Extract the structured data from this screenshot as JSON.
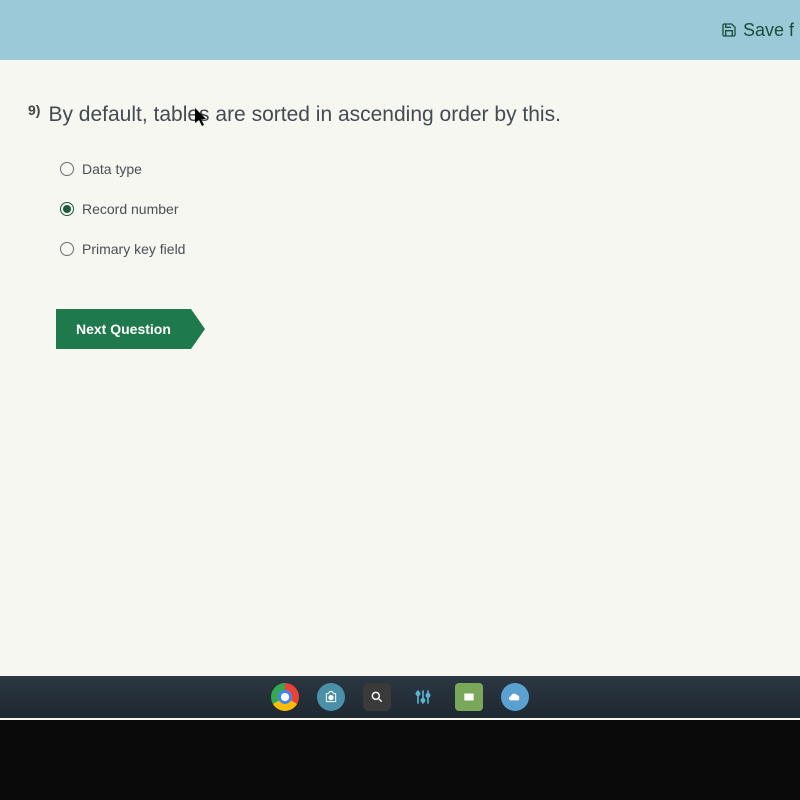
{
  "toolbar": {
    "save_label": "Save f"
  },
  "question": {
    "number": "9)",
    "text": "By default, tables are sorted in ascending order by this."
  },
  "options": [
    {
      "label": "Data type",
      "selected": false
    },
    {
      "label": "Record number",
      "selected": true
    },
    {
      "label": "Primary key field",
      "selected": false
    }
  ],
  "next_button": "Next Question"
}
